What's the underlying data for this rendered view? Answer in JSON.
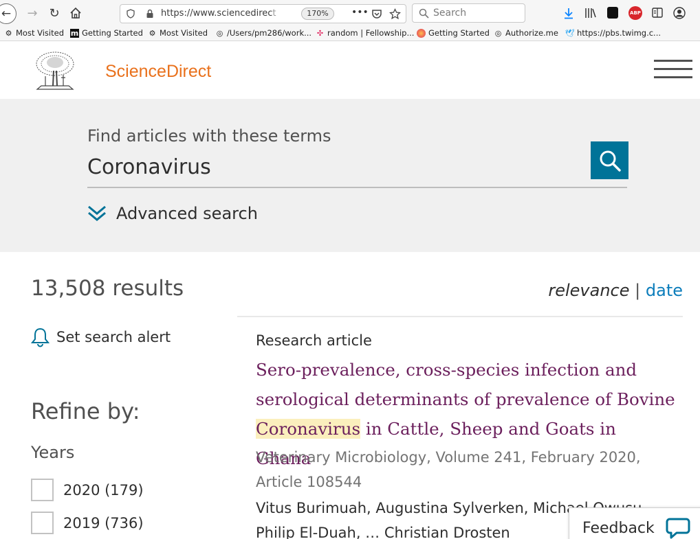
{
  "browser": {
    "url_main": "https://www.sciencedirec",
    "url_fade": "t",
    "zoom": "170%",
    "more": "•••",
    "search_placeholder": "Search",
    "bookmarks": [
      {
        "label": "Most Visited",
        "icon": "gear-icon"
      },
      {
        "label": "Getting Started",
        "icon": "m-icon"
      },
      {
        "label": "Most Visited",
        "icon": "gear-icon"
      },
      {
        "label": "/Users/pm286/work...",
        "icon": "globe-icon"
      },
      {
        "label": "random | Fellowship...",
        "icon": "slack-icon"
      },
      {
        "label": "Getting Started",
        "icon": "firefox-icon"
      },
      {
        "label": "Authorize.me",
        "icon": "globe-icon"
      },
      {
        "label": "https://pbs.twimg.c...",
        "icon": "twitter-icon"
      }
    ]
  },
  "site": {
    "brand": "ScienceDirect",
    "brand_color": "#e9711c"
  },
  "search": {
    "label": "Find articles with these terms",
    "query": "Coronavirus",
    "advanced": "Advanced search",
    "button_color": "#007398"
  },
  "results": {
    "count": "13,508 results",
    "sort_relevance": "relevance",
    "sort_sep": "|",
    "sort_date": "date",
    "alert": "Set search alert",
    "refine": "Refine by:",
    "years_heading": "Years",
    "facets": [
      {
        "label": "2020 (179)"
      },
      {
        "label": "2019 (736)"
      }
    ]
  },
  "article": {
    "type": "Research article",
    "title_part1": "Sero-prevalence, cross-species infection and serological determinants of prevalence of Bovine",
    "title_highlight": "Coronavirus",
    "title_part2": "in Cattle, Sheep and Goats in Ghana",
    "meta": "Veterinary Microbiology, Volume 241, February 2020, Article 108544",
    "authors": "Vitus Burimuah, Augustina Sylverken, Michael Owusu, Philip El-Duah, … Christian Drosten"
  },
  "feedback": {
    "label": "Feedback"
  }
}
